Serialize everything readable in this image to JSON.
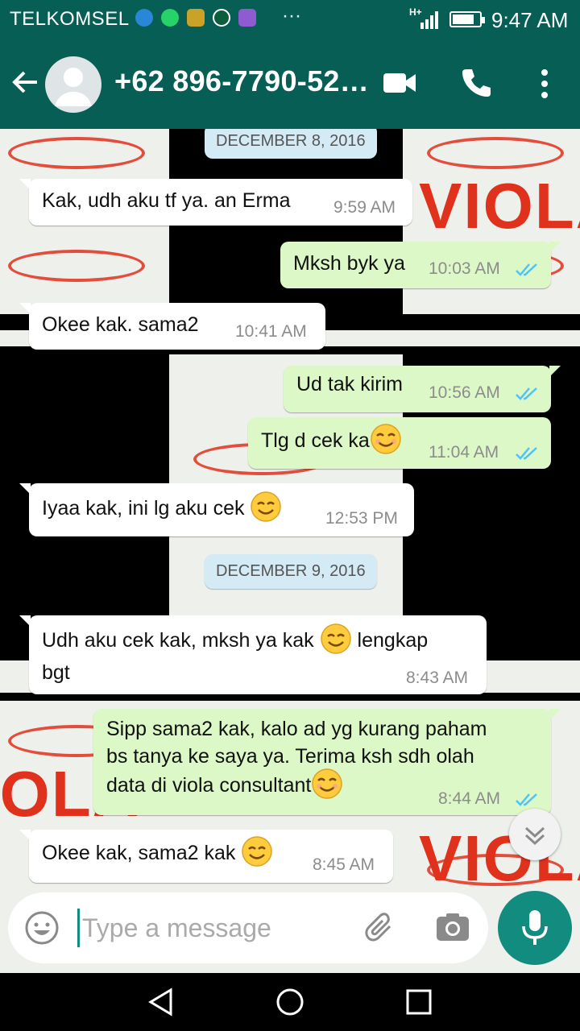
{
  "status": {
    "carrier": "TELKOMSEL",
    "dots": "···",
    "network": "H+",
    "time": "9:47 AM"
  },
  "header": {
    "contact": "+62 896-7790-52…"
  },
  "dates": [
    "DECEMBER 8, 2016",
    "DECEMBER 9, 2016"
  ],
  "messages": [
    {
      "dir": "in",
      "text": "Kak, udh aku tf ya. an Erma",
      "time": "9:59 AM"
    },
    {
      "dir": "out",
      "text": "Mksh byk ya",
      "time": "10:03 AM",
      "read": true
    },
    {
      "dir": "in",
      "text": "Okee kak. sama2",
      "time": "10:41 AM"
    },
    {
      "dir": "out",
      "text": "Ud tak kirim",
      "time": "10:56 AM",
      "read": true
    },
    {
      "dir": "out",
      "text": "Tlg d cek ka",
      "time": "11:04 AM",
      "read": true,
      "emoji": "smiling-face"
    },
    {
      "dir": "in",
      "text": "Iyaa kak, ini lg aku cek",
      "time": "12:53 PM",
      "emoji": "smiling-face"
    },
    {
      "dir": "in",
      "text_line1": "Udh aku cek kak, mksh ya kak",
      "text_line1b": "lengkap",
      "text_line2": "bgt",
      "time": "8:43 AM",
      "emoji": "smiling-face"
    },
    {
      "dir": "out",
      "text_line1": "Sipp sama2 kak, kalo ad yg kurang paham",
      "text_line2": "bs tanya ke saya ya. Terima ksh sdh olah",
      "text_line3": "data di viola consultant",
      "time": "8:44 AM",
      "read": true,
      "emoji": "smiling-face"
    },
    {
      "dir": "in",
      "text": "Okee kak, sama2 kak",
      "time": "8:45 AM",
      "emoji": "smiling-face"
    }
  ],
  "wallpaper": {
    "logo": "VIOLA"
  },
  "input": {
    "placeholder": "Type a message"
  },
  "colors": {
    "header": "#075e54",
    "outgoing": "#dcf8c6",
    "incoming": "#ffffff",
    "accent": "#128c7e",
    "read_ticks": "#4fc3f7"
  }
}
